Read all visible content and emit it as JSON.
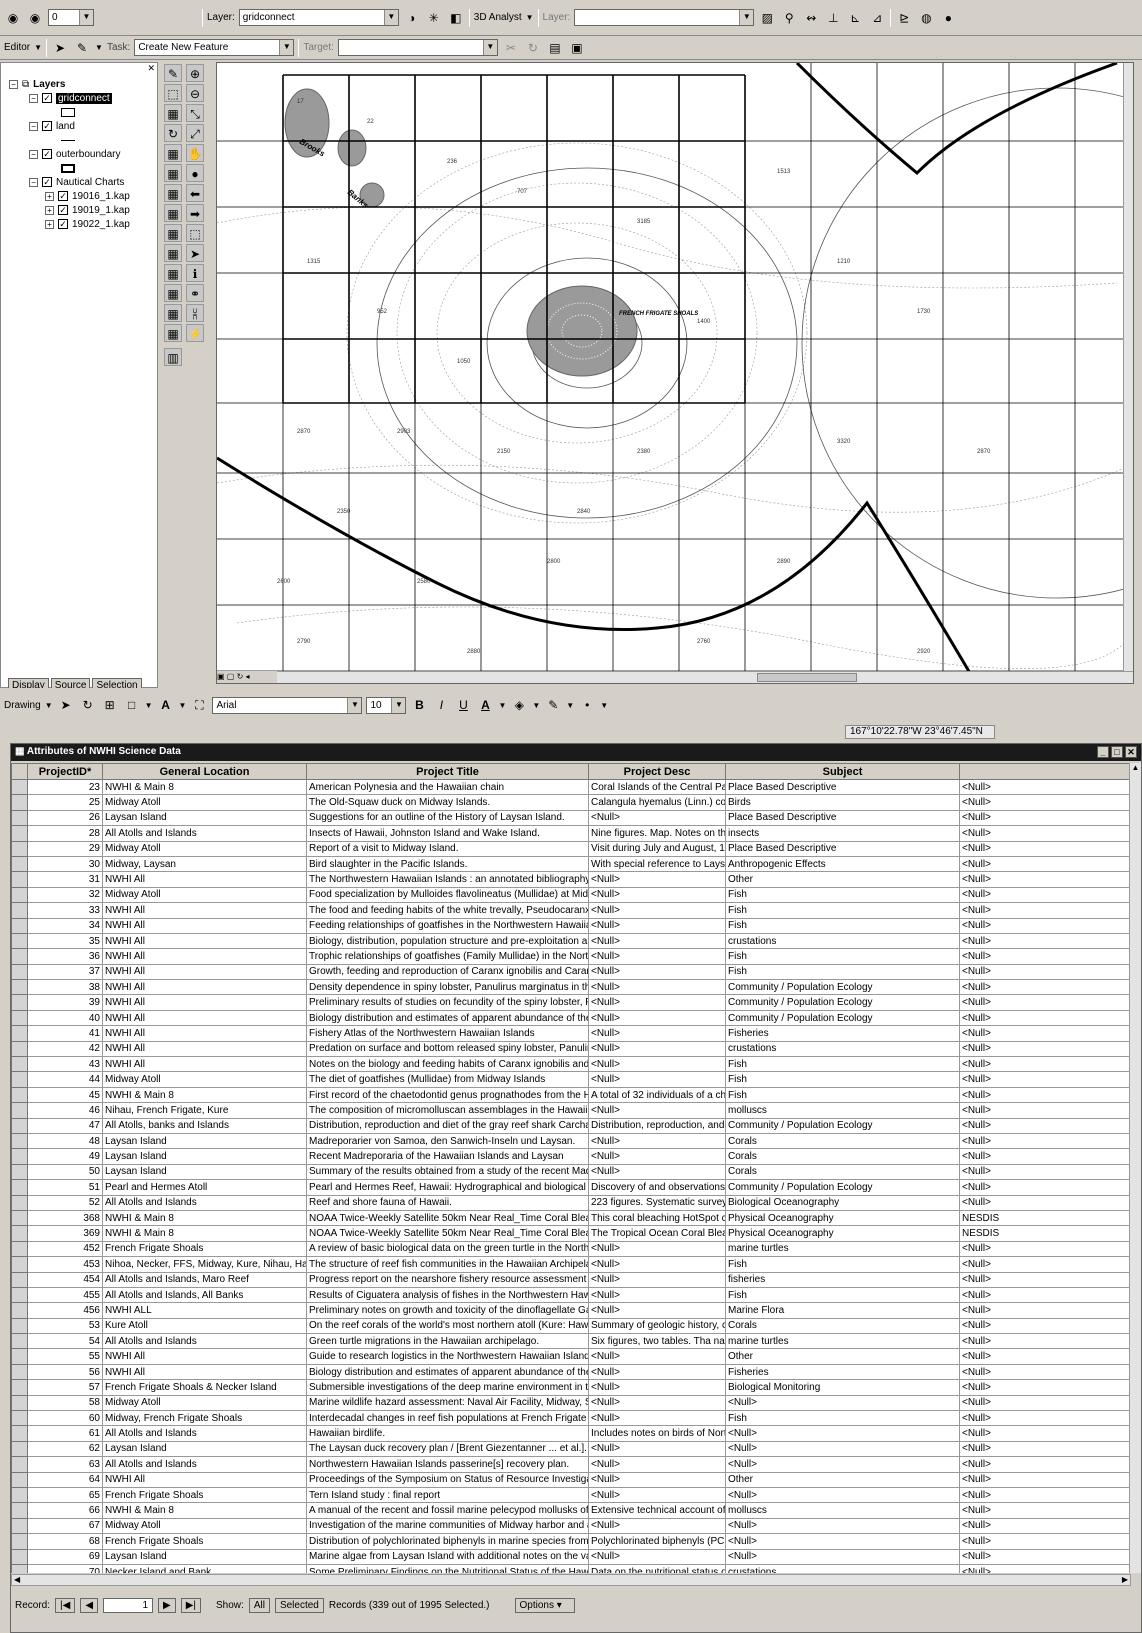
{
  "toolbar1": {
    "scale_value": "0",
    "layer_label": "Layer:",
    "layer_value": "gridconnect",
    "analyst_label": "3D Analyst",
    "layer2_label": "Layer:"
  },
  "toolbar2": {
    "editor_label": "Editor",
    "task_label": "Task:",
    "task_value": "Create New Feature",
    "target_label": "Target:"
  },
  "toc": {
    "title": "Layers",
    "layers": [
      {
        "name": "gridconnect"
      },
      {
        "name": "land"
      },
      {
        "name": "outerboundary"
      },
      {
        "name": "Nautical Charts"
      },
      {
        "name": "19016_1.kap"
      },
      {
        "name": "19019_1.kap"
      },
      {
        "name": "19022_1.kap"
      }
    ],
    "tabs": [
      "Display",
      "Source",
      "Selection"
    ]
  },
  "map": {
    "labels": [
      "Brooks Banks",
      "FRENCH FRIGATE SHOALS",
      "Brooks",
      "Banks"
    ]
  },
  "drawing": {
    "label": "Drawing",
    "font": "Arial",
    "size": "10"
  },
  "status": {
    "coordinates": "167°10'22.78\"W  23°46'7.45\"N"
  },
  "attributes": {
    "title": "Attributes of NWHI Science Data",
    "columns": [
      "ProjectID*",
      "General Location",
      "Project Title",
      "Project Desc",
      "Subject",
      ""
    ],
    "rows": [
      [
        "23",
        "NWHI & Main 8",
        "American Polynesia and the Hawaiian chain",
        "Coral Islands of the Central Paci",
        "Place Based Descriptive",
        "<Null>"
      ],
      [
        "25",
        "Midway Atoll",
        "The Old-Squaw duck on Midway Islands.",
        "Calangula hyemalus (Linn.) colle",
        "Birds",
        "<Null>"
      ],
      [
        "26",
        "Laysan Island",
        "Suggestions for an outline of the History of Laysan Island.",
        "<Null>",
        "Place Based Descriptive",
        "<Null>"
      ],
      [
        "28",
        "All Atolls and Islands",
        "Insects of Hawaii, Johnston Island and Wake Island.",
        "Nine figures.  Map.  Notes on th",
        "insects",
        "<Null>"
      ],
      [
        "29",
        "Midway Atoll",
        "Report of a visit to Midway Island.",
        "Visit during July and August, 19",
        "Place Based Descriptive",
        "<Null>"
      ],
      [
        "30",
        "Midway, Laysan",
        "Bird slaughter in the Pacific Islands.",
        "With special reference to Laysa",
        "Anthropogenic Effects",
        "<Null>"
      ],
      [
        "31",
        "NWHI All",
        "The Northwestern Hawaiian Islands : an annotated bibliography.",
        "<Null>",
        "Other",
        "<Null>"
      ],
      [
        "32",
        "Midway Atoll",
        "Food specialization by Mulloides flavolineatus (Mullidae) at Midway",
        "<Null>",
        "Fish",
        "<Null>"
      ],
      [
        "33",
        "NWHI All",
        "The food and feeding habits of the white trevally, Pseudocaranx d",
        "<Null>",
        "Fish",
        "<Null>"
      ],
      [
        "34",
        "NWHI All",
        "Feeding relationships of goatfishes in the Northwestern Hawaiian Is",
        "<Null>",
        "Fish",
        "<Null>"
      ],
      [
        "35",
        "NWHI All",
        "Biology, distribution, population structure and pre-exploitation abun",
        "<Null>",
        "crustations",
        "<Null>"
      ],
      [
        "36",
        "NWHI All",
        "Trophic relationships of goatfishes (Family Mullidae) in the Northwe",
        "<Null>",
        "Fish",
        "<Null>"
      ],
      [
        "37",
        "NWHI All",
        "Growth, feeding and reproduction of Caranx ignobilis and Caranx m",
        "<Null>",
        "Fish",
        "<Null>"
      ],
      [
        "38",
        "NWHI All",
        "Density dependence in spiny lobster, Panulirus marginatus in the N",
        "<Null>",
        "Community / Population Ecology",
        "<Null>"
      ],
      [
        "39",
        "NWHI All",
        "Preliminary results of studies on fecundity of the spiny lobster, Panu",
        "<Null>",
        "Community / Population Ecology",
        "<Null>"
      ],
      [
        "40",
        "NWHI All",
        "Biology distribution and estimates of apparent abundance of the spi",
        "<Null>",
        "Community / Population Ecology",
        "<Null>"
      ],
      [
        "41",
        "NWHI All",
        "Fishery Atlas of the Northwestern Hawaiian Islands",
        "<Null>",
        "Fisheries",
        "<Null>"
      ],
      [
        "42",
        "NWHI All",
        "Predation on surface and bottom released spiny lobster, Panulirus",
        "<Null>",
        "crustations",
        "<Null>"
      ],
      [
        "43",
        "NWHI All",
        "Notes on the biology and feeding habits of Caranx ignobilis and Car",
        "<Null>",
        "Fish",
        "<Null>"
      ],
      [
        "44",
        "Midway Atoll",
        "The diet of goatfishes (Mullidae) from Midway Islands",
        "<Null>",
        "Fish",
        "<Null>"
      ],
      [
        "45",
        "NWHI & Main 8",
        "First record of the chaetodontid genus prognathodes from the Haw",
        "A total of 32 individuals of a cha",
        "Fish",
        "<Null>"
      ],
      [
        "46",
        "Nihau, French Frigate, Kure",
        "The composition of micromolluscan assemblages in the Hawaiian A",
        "<Null>",
        "molluscs",
        "<Null>"
      ],
      [
        "47",
        "All Atolls, banks and Islands",
        "Distribution, reproduction and diet of the gray reef shark Carcharhin",
        "Distribution, reproduction, and di",
        "Community / Population Ecology",
        "<Null>"
      ],
      [
        "48",
        "Laysan Island",
        "Madreporarier von Samoa, den Sanwich-Inseln und Laysan.",
        "<Null>",
        "Corals",
        "<Null>"
      ],
      [
        "49",
        "Laysan Island",
        "Recent Madreporaria of the Hawaiian Islands and Laysan",
        "<Null>",
        "Corals",
        "<Null>"
      ],
      [
        "50",
        "Laysan Island",
        "Summary of the results obtained from a study of the recent Madrep",
        "<Null>",
        "Corals",
        "<Null>"
      ],
      [
        "51",
        "Pearl and Hermes Atoll",
        "Pearl and Hermes Reef, Hawaii: Hydrographical and biological obs",
        "Discovery of and observations o",
        "Community / Population Ecology",
        "<Null>"
      ],
      [
        "52",
        "All Atolls and Islands",
        "Reef and shore fauna of Hawaii.",
        "223 figures.  Systematic surveyo",
        "Biological Oceanography",
        "<Null>"
      ],
      [
        "368",
        "NWHI & Main 8",
        "NOAA Twice-Weekly Satellite 50km Near Real_Time Coral Bleachi",
        "This coral bleaching HotSpot ch",
        "Physical Oceanography",
        "NESDIS"
      ],
      [
        "369",
        "NWHI & Main 8",
        "NOAA Twice-Weekly Satellite 50km Near Real_Time Coral Bleachi",
        "The Tropical Ocean Coral Bleac",
        "Physical Oceanography",
        "NESDIS"
      ],
      [
        "452",
        "French Frigate Shoals",
        "A review of basic biological data on the green turtle in the Northwe",
        "<Null>",
        "marine turtles",
        "<Null>"
      ],
      [
        "453",
        "Nihoa, Necker, FFS, Midway, Kure, Nihau, Haw",
        "The structure of reef fish communities in the Hawaiian Archipelago:",
        "<Null>",
        "Fish",
        "<Null>"
      ],
      [
        "454",
        "All Atolls and Islands, Maro Reef",
        "Progress report on the nearshore fishery resource assessment of th",
        "<Null>",
        "fisheries",
        "<Null>"
      ],
      [
        "455",
        "All Atolls and Islands, All Banks",
        "Results of Ciguatera analysis of fishes in the Northwestern Hawaiia",
        "<Null>",
        "Fish",
        "<Null>"
      ],
      [
        "456",
        "NWHI ALL",
        "Preliminary notes on growth and toxicity of the dinoflagellate Gambi",
        "<Null>",
        "Marine Flora",
        "<Null>"
      ],
      [
        "53",
        "Kure Atoll",
        "On the reef corals of the world's most northern atoll (Kure: Hawaiia",
        "Summary of geologic history, co",
        "Corals",
        "<Null>"
      ],
      [
        "54",
        "All Atolls and Islands",
        "Green turtle migrations in the Hawaiian archipelago.",
        "Six figures, two tables.  Tha nat",
        "marine turtles",
        "<Null>"
      ],
      [
        "55",
        "NWHI All",
        "Guide to research logistics in the Northwestern Hawaiian Islands.",
        "<Null>",
        "Other",
        "<Null>"
      ],
      [
        "56",
        "NWHI All",
        "Biology distribution and estimates of apparent abundance of the spi",
        "<Null>",
        "Fisheries",
        "<Null>"
      ],
      [
        "57",
        "French Frigate Shoals & Necker Island",
        "Submersible investigations of the deep marine environment in the v",
        "<Null>",
        "Biological Monitoring",
        "<Null>"
      ],
      [
        "58",
        "Midway Atoll",
        "Marine wildlife hazard assessment: Naval Air Facility, Midway, San",
        "<Null>",
        "<Null>",
        "<Null>"
      ],
      [
        "60",
        "Midway, French Frigate Shoals",
        "Interdecadal changes in reef fish populations at French Frigate Sh",
        "<Null>",
        "Fish",
        "<Null>"
      ],
      [
        "61",
        "All Atolls and Islands",
        "Hawaiian birdlife.",
        "Includes notes on birds of North",
        "<Null>",
        "<Null>"
      ],
      [
        "62",
        "Laysan Island",
        "The Laysan duck recovery plan / [Brent Giezentanner ... et al.].",
        "<Null>",
        "<Null>",
        "<Null>"
      ],
      [
        "63",
        "All Atolls and Islands",
        "Northwestern Hawaiian Islands passerine[s] recovery plan.",
        "<Null>",
        "<Null>",
        "<Null>"
      ],
      [
        "64",
        "NWHI All",
        "Proceedings of the Symposium on Status of Resource Investigatio",
        "<Null>",
        "Other",
        "<Null>"
      ],
      [
        "65",
        "French Frigate Shoals",
        "Tern Island study : final report",
        "<Null>",
        "<Null>",
        "<Null>"
      ],
      [
        "66",
        "NWHI & Main 8",
        "A manual of the recent and fossil marine pelecypod mollusks of the",
        "Extensive technical account of",
        "molluscs",
        "<Null>"
      ],
      [
        "67",
        "Midway Atoll",
        "Investigation of the marine communities of Midway harbor and adja",
        "<Null>",
        "<Null>",
        "<Null>"
      ],
      [
        "68",
        "French Frigate Shoals",
        "Distribution of polychlorinated biphenyls in marine species from Fre",
        "Polychlorinated biphenyls (PCBs",
        "<Null>",
        "<Null>"
      ],
      [
        "69",
        "Laysan Island",
        "Marine algae from Laysan Island with additional notes on the vasc",
        "<Null>",
        "<Null>",
        "<Null>"
      ],
      [
        "70",
        "Necker Island and Bank",
        "Some Preliminary Findings on the Nutritional Status of the Hawaiian",
        "Data on the nutritional status of",
        "crustations",
        "<Null>"
      ]
    ],
    "record_label": "Record:",
    "record_value": "1",
    "show_label": "Show:",
    "all_button": "All",
    "selected_button": "Selected",
    "records_text": "Records  (339 out of 1995 Selected.)",
    "options_button": "Options"
  }
}
